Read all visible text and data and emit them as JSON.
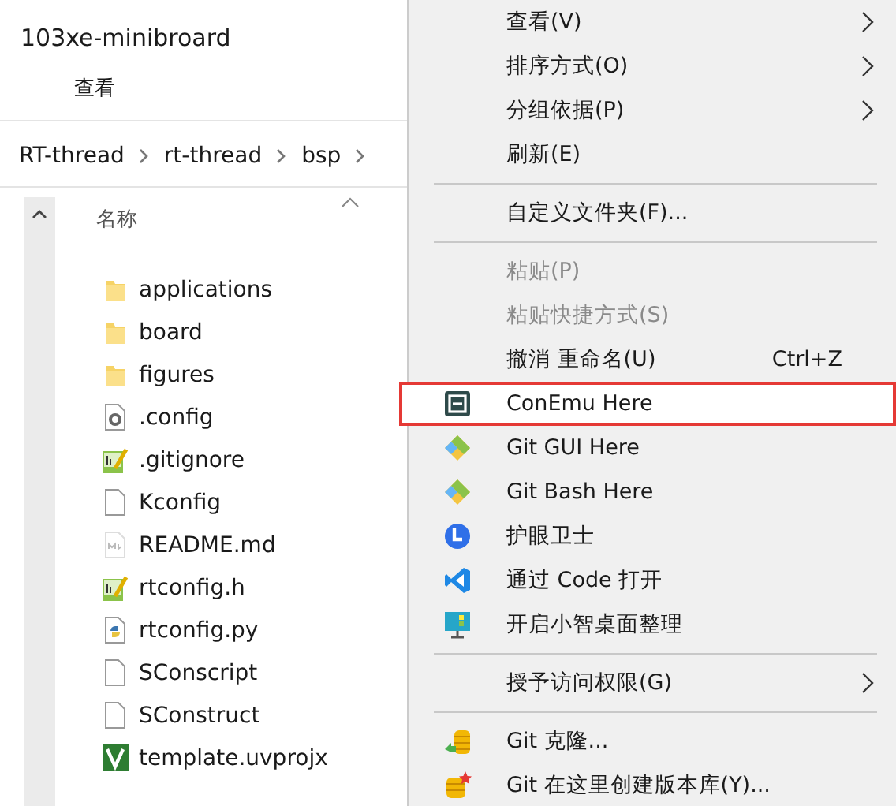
{
  "explorer": {
    "title": "103xe-minibroard",
    "ribbon_tabs": [
      {
        "label": "查看",
        "selected": false
      }
    ],
    "breadcrumb": [
      "RT-thread",
      "rt-thread",
      "bsp"
    ],
    "columns": [
      "名称"
    ],
    "files": [
      {
        "name": "applications",
        "kind": "folder"
      },
      {
        "name": "board",
        "kind": "folder"
      },
      {
        "name": "figures",
        "kind": "folder"
      },
      {
        "name": ".config",
        "kind": "settings"
      },
      {
        "name": ".gitignore",
        "kind": "notepad"
      },
      {
        "name": "Kconfig",
        "kind": "blank"
      },
      {
        "name": "README.md",
        "kind": "markdown"
      },
      {
        "name": "rtconfig.h",
        "kind": "notepad"
      },
      {
        "name": "rtconfig.py",
        "kind": "python"
      },
      {
        "name": "SConscript",
        "kind": "blank"
      },
      {
        "name": "SConstruct",
        "kind": "blank"
      },
      {
        "name": "template.uvprojx",
        "kind": "project"
      }
    ]
  },
  "context_menu": {
    "items": [
      {
        "kind": "item",
        "label": "查看(V)",
        "submenu": true,
        "disabled": false,
        "selected": false
      },
      {
        "kind": "item",
        "label": "排序方式(O)",
        "submenu": true,
        "disabled": false,
        "selected": false
      },
      {
        "kind": "item",
        "label": "分组依据(P)",
        "submenu": true,
        "disabled": false,
        "selected": false
      },
      {
        "kind": "item",
        "label": "刷新(E)",
        "submenu": false,
        "disabled": false,
        "selected": false
      },
      {
        "kind": "separator"
      },
      {
        "kind": "item",
        "label": "自定义文件夹(F)...",
        "submenu": false,
        "disabled": false,
        "selected": false
      },
      {
        "kind": "separator"
      },
      {
        "kind": "item",
        "label": "粘贴(P)",
        "submenu": false,
        "disabled": true,
        "selected": false
      },
      {
        "kind": "item",
        "label": "粘贴快捷方式(S)",
        "submenu": false,
        "disabled": true,
        "selected": false
      },
      {
        "kind": "item",
        "label": "撤消 重命名(U)",
        "shortcut": "Ctrl+Z",
        "submenu": false,
        "disabled": false,
        "selected": false
      },
      {
        "kind": "item",
        "label": "ConEmu Here",
        "submenu": false,
        "disabled": false,
        "selected": true
      },
      {
        "kind": "item",
        "label": "Git GUI Here",
        "submenu": false,
        "disabled": false,
        "selected": false
      },
      {
        "kind": "item",
        "label": "Git Bash Here",
        "submenu": false,
        "disabled": false,
        "selected": false
      },
      {
        "kind": "item",
        "label": "护眼卫士",
        "submenu": false,
        "disabled": false,
        "selected": false
      },
      {
        "kind": "item",
        "label": "通过 Code 打开",
        "submenu": false,
        "disabled": false,
        "selected": false
      },
      {
        "kind": "item",
        "label": "开启小智桌面整理",
        "submenu": false,
        "disabled": false,
        "selected": false
      },
      {
        "kind": "separator"
      },
      {
        "kind": "item",
        "label": "授予访问权限(G)",
        "submenu": true,
        "disabled": false,
        "selected": false
      },
      {
        "kind": "separator"
      },
      {
        "kind": "item",
        "label": "Git 克隆...",
        "submenu": false,
        "disabled": false,
        "selected": false
      },
      {
        "kind": "item",
        "label": "Git 在这里创建版本库(Y)...",
        "submenu": false,
        "disabled": false,
        "selected": false
      }
    ]
  }
}
